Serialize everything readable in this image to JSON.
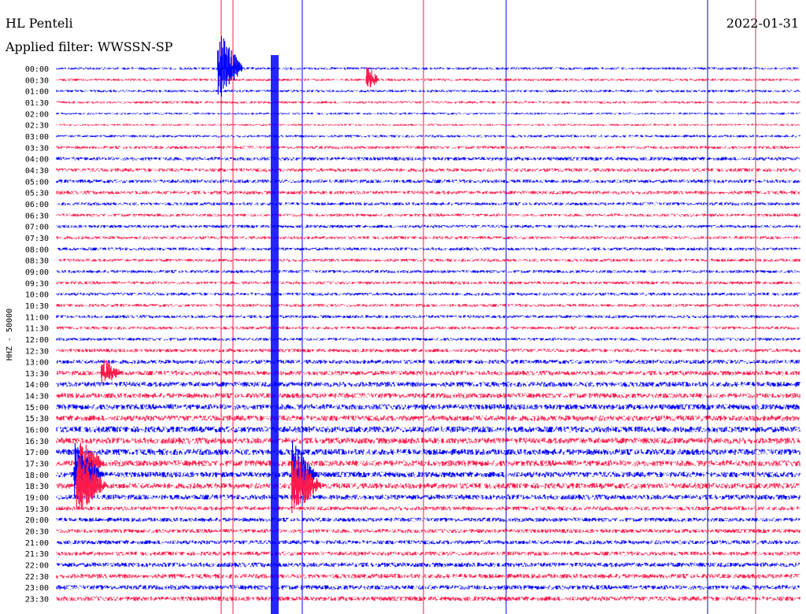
{
  "header": {
    "station": "HL Penteli",
    "filter": "Applied filter: WWSSN-SP",
    "date": "2022-01-31"
  },
  "chart_data": {
    "type": "line",
    "title": "HL Penteli",
    "subtitle": "Applied filter: WWSSN-SP",
    "date": "2022-01-31",
    "ylabel": "HHZ - 50000",
    "trace_colors": [
      "#0000ff",
      "#ff1a4b"
    ],
    "row_labels": [
      "00:00",
      "00:30",
      "01:00",
      "01:30",
      "02:00",
      "02:30",
      "03:00",
      "03:30",
      "04:00",
      "04:30",
      "05:00",
      "05:30",
      "06:00",
      "06:30",
      "07:00",
      "07:30",
      "08:00",
      "08:30",
      "09:00",
      "09:30",
      "10:00",
      "10:30",
      "11:00",
      "11:30",
      "12:00",
      "12:30",
      "13:00",
      "13:30",
      "14:00",
      "14:30",
      "15:00",
      "15:30",
      "16:00",
      "16:30",
      "17:00",
      "17:30",
      "18:00",
      "18:30",
      "19:00",
      "19:30",
      "20:00",
      "20:30",
      "21:00",
      "21:30",
      "22:00",
      "22:30",
      "23:00",
      "23:30"
    ],
    "row_noise": [
      0.5,
      0.5,
      0.5,
      0.5,
      0.4,
      0.4,
      0.5,
      0.6,
      0.7,
      0.7,
      0.7,
      0.7,
      0.6,
      0.6,
      0.6,
      0.6,
      0.6,
      0.6,
      0.6,
      0.6,
      0.6,
      0.6,
      0.6,
      0.6,
      0.6,
      0.7,
      0.8,
      0.9,
      1.0,
      1.0,
      1.1,
      1.1,
      1.2,
      1.2,
      1.2,
      1.2,
      1.1,
      1.1,
      1.0,
      0.8,
      0.8,
      0.8,
      0.8,
      0.8,
      0.9,
      0.9,
      0.9,
      0.9
    ],
    "events": [
      {
        "row": 0,
        "minute": 6.5,
        "amplitude": 3.5,
        "duration_min": 1.0
      },
      {
        "row": 1,
        "minute": 12.5,
        "amplitude": 1.2,
        "duration_min": 0.5
      },
      {
        "row": 27,
        "minute": 1.8,
        "amplitude": 1.3,
        "duration_min": 0.8
      },
      {
        "row": 35,
        "minute": 0.9,
        "amplitude": 2.2,
        "duration_min": 1.0
      },
      {
        "row": 36,
        "minute": 0.7,
        "amplitude": 2.8,
        "duration_min": 1.2
      },
      {
        "row": 37,
        "minute": 0.8,
        "amplitude": 3.0,
        "duration_min": 1.2
      },
      {
        "row": 36,
        "minute": 9.5,
        "amplitude": 3.0,
        "duration_min": 1.0
      },
      {
        "row": 37,
        "minute": 9.5,
        "amplitude": 3.0,
        "duration_min": 1.2
      }
    ]
  }
}
